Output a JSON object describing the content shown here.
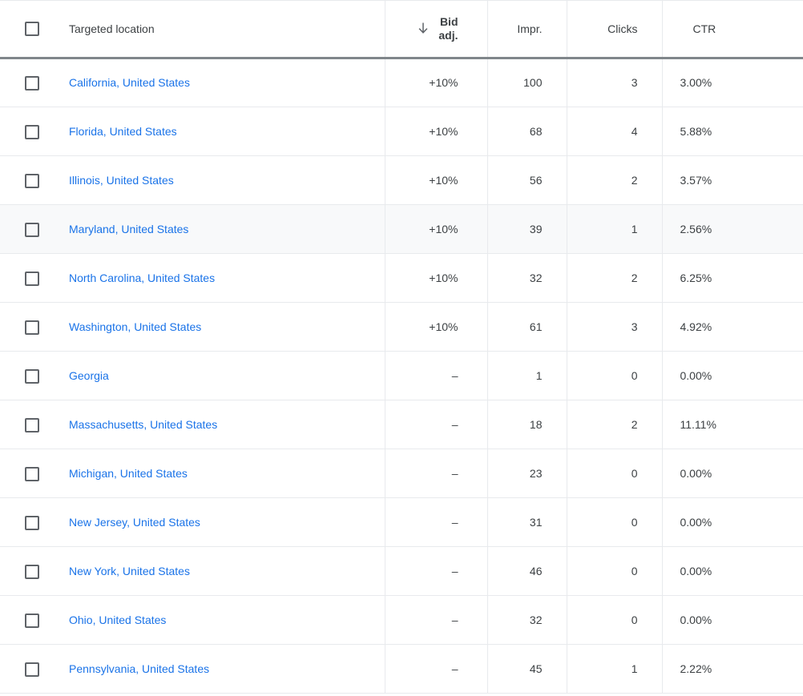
{
  "table": {
    "columns": [
      {
        "key": "checkbox",
        "label": "",
        "icon": "select-all-checkbox"
      },
      {
        "key": "location",
        "label": "Targeted location",
        "align": "left"
      },
      {
        "key": "bid_adj",
        "label": "Bid adj.",
        "align": "right",
        "sorted": true,
        "sort_direction": "descending",
        "sort_icon": "arrow-down-icon"
      },
      {
        "key": "impressions",
        "label": "Impr.",
        "align": "right"
      },
      {
        "key": "clicks",
        "label": "Clicks",
        "align": "right"
      },
      {
        "key": "ctr",
        "label": "CTR",
        "align": "left"
      }
    ],
    "header": {
      "location_label": "Targeted location",
      "bid_adj_label_line1": "Bid",
      "bid_adj_label_line2": "adj.",
      "impr_label": "Impr.",
      "clicks_label": "Clicks",
      "ctr_label": "CTR"
    },
    "rows": [
      {
        "location": "California, United States",
        "bid_adj": "+10%",
        "impr": "100",
        "clicks": "3",
        "ctr": "3.00%",
        "highlighted": false
      },
      {
        "location": "Florida, United States",
        "bid_adj": "+10%",
        "impr": "68",
        "clicks": "4",
        "ctr": "5.88%",
        "highlighted": false
      },
      {
        "location": "Illinois, United States",
        "bid_adj": "+10%",
        "impr": "56",
        "clicks": "2",
        "ctr": "3.57%",
        "highlighted": false
      },
      {
        "location": "Maryland, United States",
        "bid_adj": "+10%",
        "impr": "39",
        "clicks": "1",
        "ctr": "2.56%",
        "highlighted": true
      },
      {
        "location": "North Carolina, United States",
        "bid_adj": "+10%",
        "impr": "32",
        "clicks": "2",
        "ctr": "6.25%",
        "highlighted": false
      },
      {
        "location": "Washington, United States",
        "bid_adj": "+10%",
        "impr": "61",
        "clicks": "3",
        "ctr": "4.92%",
        "highlighted": false
      },
      {
        "location": "Georgia",
        "bid_adj": "–",
        "impr": "1",
        "clicks": "0",
        "ctr": "0.00%",
        "highlighted": false
      },
      {
        "location": "Massachusetts, United States",
        "bid_adj": "–",
        "impr": "18",
        "clicks": "2",
        "ctr": "11.11%",
        "highlighted": false
      },
      {
        "location": "Michigan, United States",
        "bid_adj": "–",
        "impr": "23",
        "clicks": "0",
        "ctr": "0.00%",
        "highlighted": false
      },
      {
        "location": "New Jersey, United States",
        "bid_adj": "–",
        "impr": "31",
        "clicks": "0",
        "ctr": "0.00%",
        "highlighted": false
      },
      {
        "location": "New York, United States",
        "bid_adj": "–",
        "impr": "46",
        "clicks": "0",
        "ctr": "0.00%",
        "highlighted": false
      },
      {
        "location": "Ohio, United States",
        "bid_adj": "–",
        "impr": "32",
        "clicks": "0",
        "ctr": "0.00%",
        "highlighted": false
      },
      {
        "location": "Pennsylvania, United States",
        "bid_adj": "–",
        "impr": "45",
        "clicks": "1",
        "ctr": "2.22%",
        "highlighted": false
      }
    ]
  },
  "colors": {
    "link": "#1a73e8",
    "text": "#3c4043",
    "header_rule": "#80868b",
    "row_divider": "#e8eaed",
    "row_highlight": "#f8f9fa",
    "checkbox_border": "#5f6368"
  }
}
